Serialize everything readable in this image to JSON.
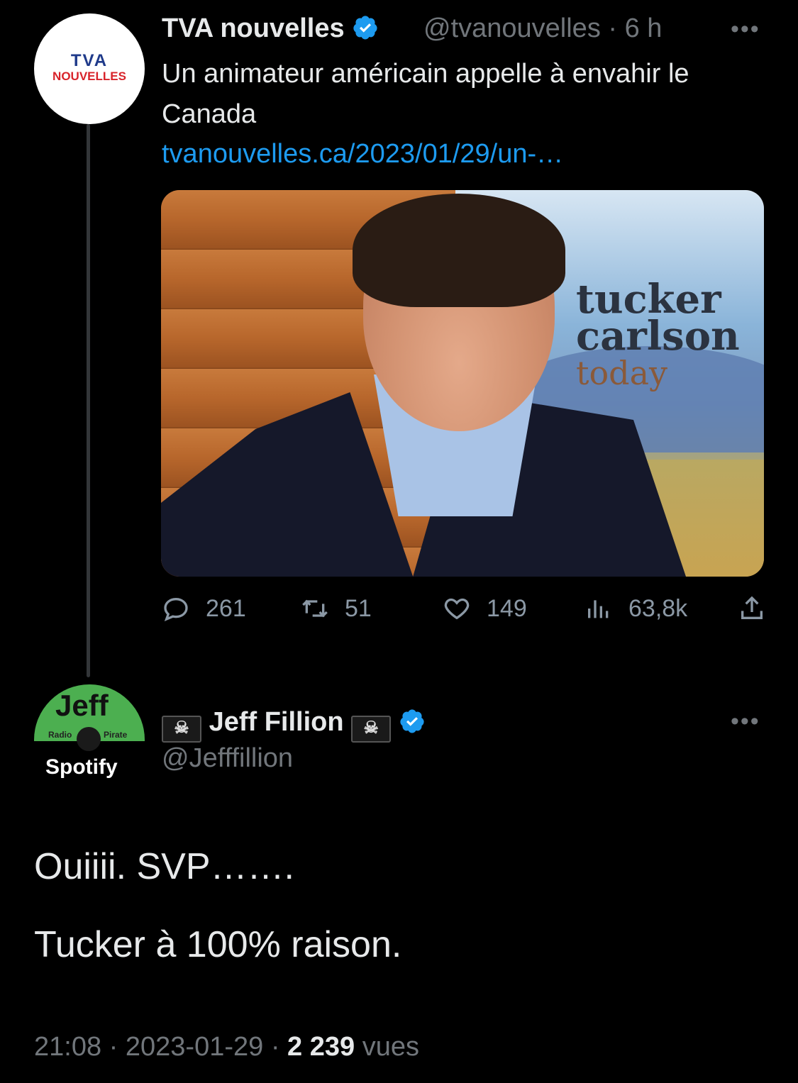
{
  "parent_tweet": {
    "avatar_logo_top": "TVA",
    "avatar_logo_bottom": "NOUVELLES",
    "display_name": "TVA nouvelles",
    "handle": "@tvanouvelles",
    "time": "6 h",
    "text": "Un animateur américain appelle à envahir le Canada",
    "link": "tvanouvelles.ca/2023/01/29/un-…",
    "media": {
      "brand_line1": "tucker",
      "brand_line2": "carlson",
      "brand_line3": "today"
    },
    "actions": {
      "replies": "261",
      "retweets": "51",
      "likes": "149",
      "views": "63,8k"
    }
  },
  "reply_tweet": {
    "avatar_text": "Jeff",
    "avatar_radio": "Radio",
    "avatar_pirate": "Pirate",
    "avatar_spotify": "Spotify",
    "display_name": "Jeff Fillion",
    "handle": "@Jefffillion",
    "text_line1": "Ouiiii. SVP…….",
    "text_line2": "Tucker à 100% raison.",
    "time": "21:08",
    "date": "2023-01-29",
    "views_count": "2 239",
    "views_label": "vues"
  },
  "colors": {
    "background": "#000000",
    "text": "#e7e9ea",
    "muted": "#71767b",
    "link": "#1d9bf0",
    "verified": "#1d9bf0"
  },
  "icons": [
    "verified-badge-icon",
    "more-icon",
    "reply-icon",
    "retweet-icon",
    "like-icon",
    "views-icon",
    "share-icon",
    "pirate-flag-icon"
  ]
}
